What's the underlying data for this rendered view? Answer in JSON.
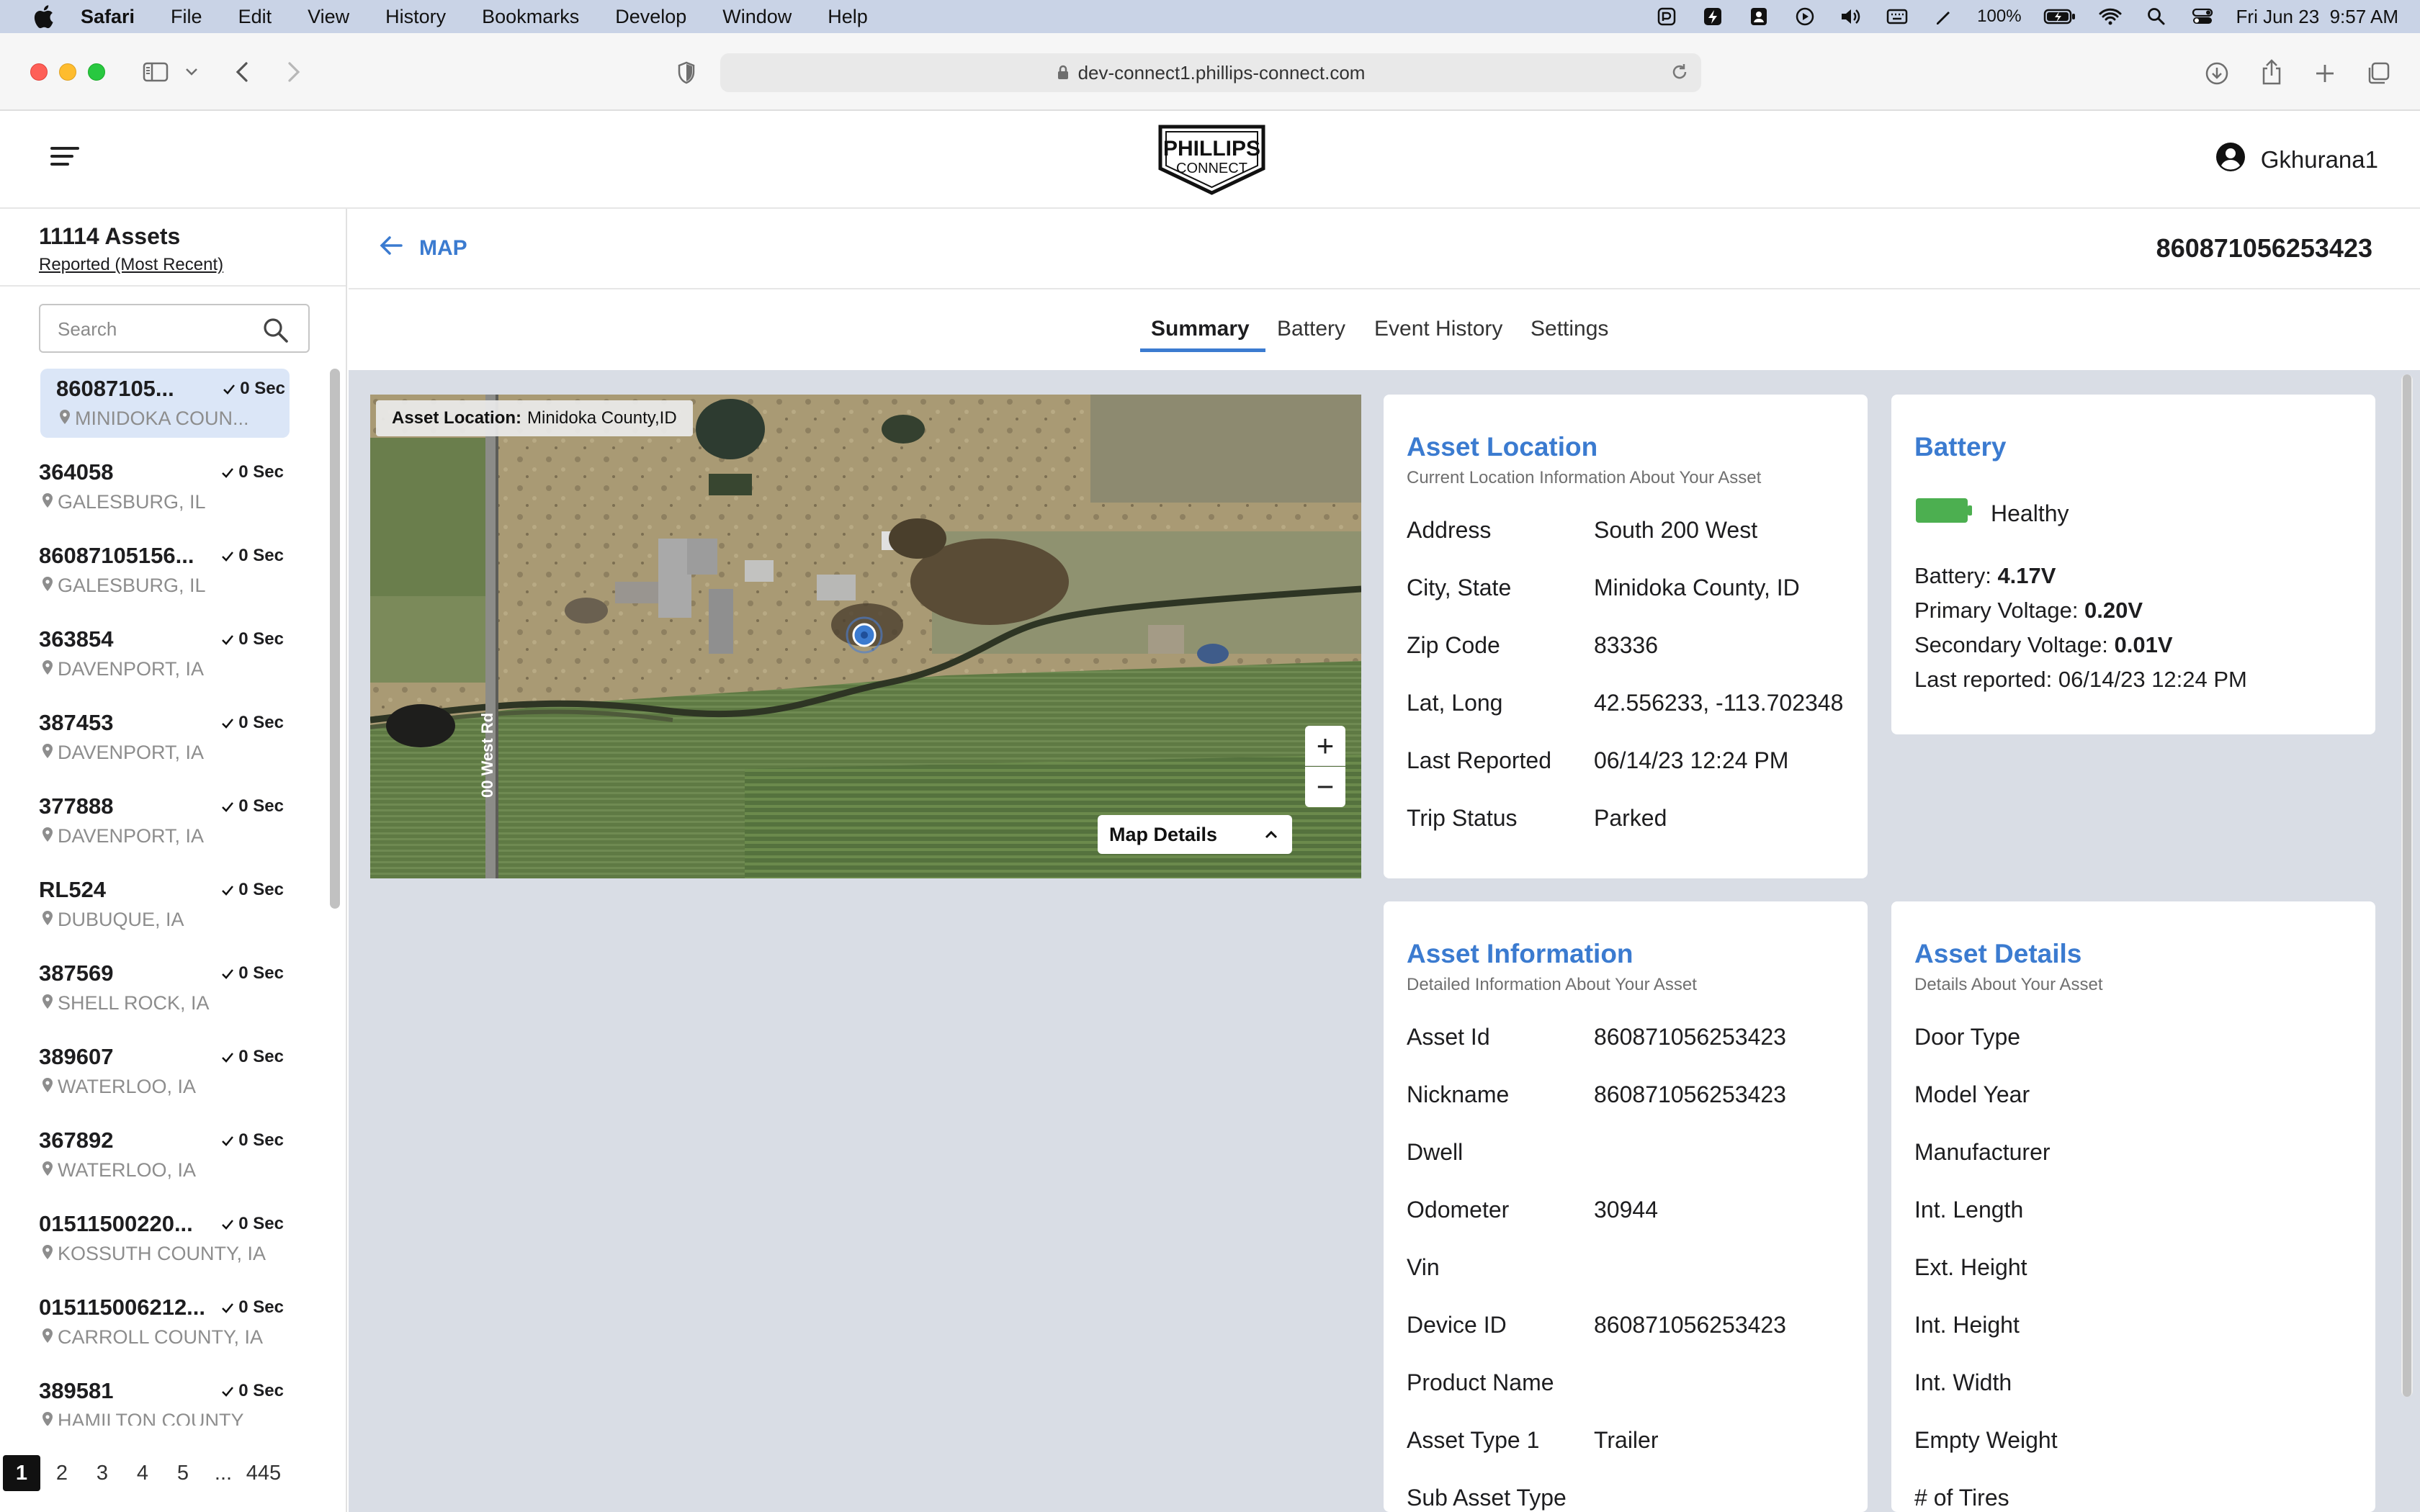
{
  "menubar": {
    "app": "Safari",
    "items": [
      "File",
      "Edit",
      "View",
      "History",
      "Bookmarks",
      "Develop",
      "Window",
      "Help"
    ],
    "battery_pct": "100%",
    "datetime": "Fri Jun 23  9:57 AM"
  },
  "browser": {
    "url": "dev-connect1.phillips-connect.com"
  },
  "header": {
    "logo_line1": "PHILLIPS",
    "logo_line2": "CONNECT",
    "username": "Gkhurana1"
  },
  "sidebar": {
    "count_label": "11114 Assets",
    "sort_label": "Reported (Most Recent)",
    "search_placeholder": "Search",
    "assets": [
      {
        "id": "86087105...",
        "time": "0 Sec",
        "location": "MINIDOKA COUN..."
      },
      {
        "id": "364058",
        "time": "0 Sec",
        "location": "GALESBURG, IL"
      },
      {
        "id": "86087105156...",
        "time": "0 Sec",
        "location": "GALESBURG, IL"
      },
      {
        "id": "363854",
        "time": "0 Sec",
        "location": "DAVENPORT, IA"
      },
      {
        "id": "387453",
        "time": "0 Sec",
        "location": "DAVENPORT, IA"
      },
      {
        "id": "377888",
        "time": "0 Sec",
        "location": "DAVENPORT, IA"
      },
      {
        "id": "RL524",
        "time": "0 Sec",
        "location": "DUBUQUE, IA"
      },
      {
        "id": "387569",
        "time": "0 Sec",
        "location": "SHELL ROCK, IA"
      },
      {
        "id": "389607",
        "time": "0 Sec",
        "location": "WATERLOO, IA"
      },
      {
        "id": "367892",
        "time": "0 Sec",
        "location": "WATERLOO, IA"
      },
      {
        "id": "01511500220...",
        "time": "0 Sec",
        "location": "KOSSUTH COUNTY, IA"
      },
      {
        "id": "015115006212...",
        "time": "0 Sec",
        "location": "CARROLL COUNTY, IA"
      },
      {
        "id": "389581",
        "time": "0 Sec",
        "location": "HAMILTON COUNTY"
      }
    ],
    "pages": [
      "1",
      "2",
      "3",
      "4",
      "5",
      "...",
      "445"
    ],
    "current_page": "1"
  },
  "main": {
    "back_label": "MAP",
    "asset_id": "860871056253423",
    "tabs": [
      "Summary",
      "Battery",
      "Event History",
      "Settings"
    ],
    "active_tab": "Summary"
  },
  "map": {
    "badge_label": "Asset Location:",
    "badge_value": "Minidoka County,ID",
    "road_label": "00 West Rd",
    "details_label": "Map Details",
    "zoom_in": "+",
    "zoom_out": "−"
  },
  "asset_location": {
    "title": "Asset Location",
    "subtitle": "Current Location Information About Your Asset",
    "rows": [
      {
        "label": "Address",
        "value": "South 200 West"
      },
      {
        "label": "City, State",
        "value": "Minidoka County, ID"
      },
      {
        "label": "Zip Code",
        "value": "83336"
      },
      {
        "label": "Lat, Long",
        "value": "42.556233, -113.702348"
      },
      {
        "label": "Last Reported",
        "value": "06/14/23 12:24 PM"
      },
      {
        "label": "Trip Status",
        "value": "Parked"
      }
    ]
  },
  "battery": {
    "title": "Battery",
    "status": "Healthy",
    "status_color": "#4caf50",
    "lines": [
      {
        "label": "Battery: ",
        "value": "4.17V",
        "bold": true
      },
      {
        "label": "Primary Voltage: ",
        "value": "0.20V",
        "bold": true
      },
      {
        "label": "Secondary Voltage: ",
        "value": "0.01V",
        "bold": true
      },
      {
        "label": "Last reported: ",
        "value": "06/14/23 12:24 PM",
        "bold": false
      }
    ]
  },
  "asset_information": {
    "title": "Asset Information",
    "subtitle": "Detailed Information About Your Asset",
    "rows": [
      {
        "label": "Asset Id",
        "value": "860871056253423"
      },
      {
        "label": "Nickname",
        "value": "860871056253423"
      },
      {
        "label": "Dwell",
        "value": ""
      },
      {
        "label": "Odometer",
        "value": "30944"
      },
      {
        "label": "Vin",
        "value": ""
      },
      {
        "label": "Device ID",
        "value": "860871056253423"
      },
      {
        "label": "Product Name",
        "value": ""
      },
      {
        "label": "Asset Type 1",
        "value": "Trailer"
      },
      {
        "label": "Sub Asset Type",
        "value": ""
      }
    ]
  },
  "asset_details": {
    "title": "Asset Details",
    "subtitle": "Details About Your Asset",
    "rows": [
      {
        "label": "Door Type"
      },
      {
        "label": "Model Year"
      },
      {
        "label": "Manufacturer"
      },
      {
        "label": "Int. Length"
      },
      {
        "label": "Ext. Height"
      },
      {
        "label": "Int. Height"
      },
      {
        "label": "Int. Width"
      },
      {
        "label": "Empty Weight"
      },
      {
        "label": "# of Tires"
      }
    ]
  },
  "colors": {
    "accent": "#3b7bd0",
    "content_bg": "#d9dde5",
    "selected_row": "#dbe6f7"
  }
}
